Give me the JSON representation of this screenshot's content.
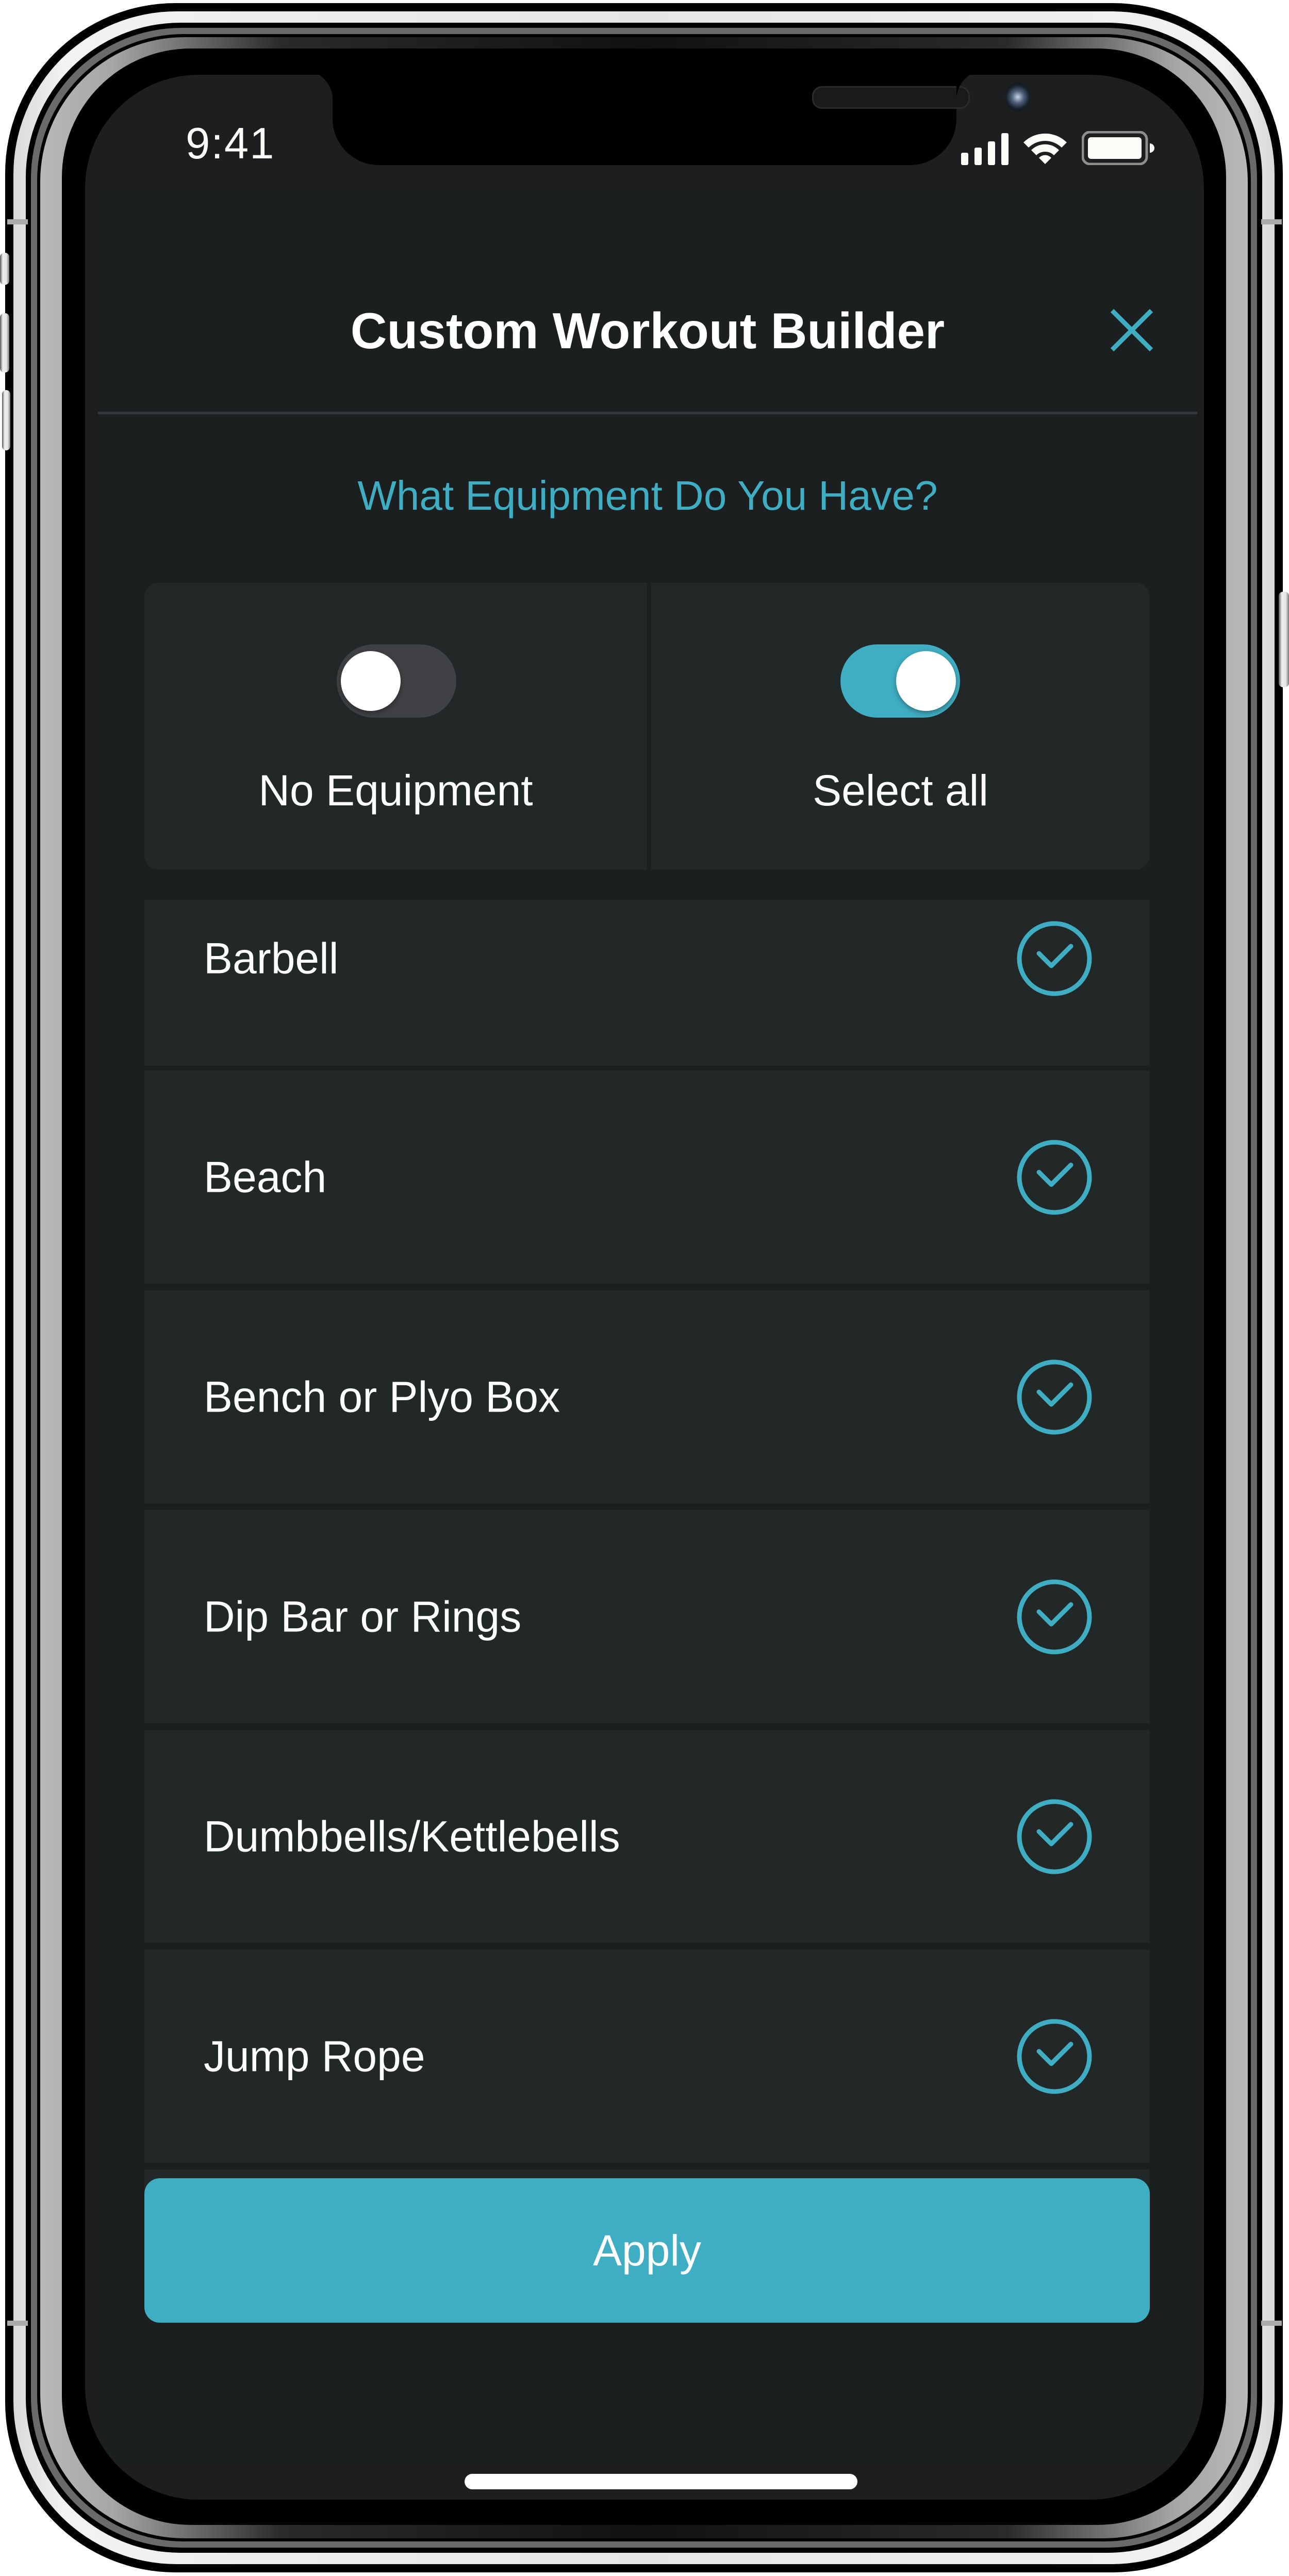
{
  "status_bar": {
    "time": "9:41",
    "icons": [
      "cellular-signal-icon",
      "wifi-icon",
      "battery-icon"
    ]
  },
  "header": {
    "title": "Custom Workout Builder",
    "close_icon": "close-icon"
  },
  "section": {
    "subtitle": "What Equipment Do You Have?"
  },
  "toggles": [
    {
      "label": "No Equipment",
      "state": "off"
    },
    {
      "label": "Select all",
      "state": "on"
    }
  ],
  "equipment": [
    {
      "label": "Barbell",
      "checked": true
    },
    {
      "label": "Beach",
      "checked": true
    },
    {
      "label": "Bench or Plyo Box",
      "checked": true
    },
    {
      "label": "Dip Bar or Rings",
      "checked": true
    },
    {
      "label": "Dumbbells/Kettlebells",
      "checked": true
    },
    {
      "label": "Jump Rope",
      "checked": true
    }
  ],
  "footer": {
    "apply_label": "Apply"
  },
  "colors": {
    "accent": "#40aec2",
    "background": "#1b1f20",
    "card": "#222728",
    "toggle_off_track": "#3f4144",
    "text": "#ffffff"
  }
}
